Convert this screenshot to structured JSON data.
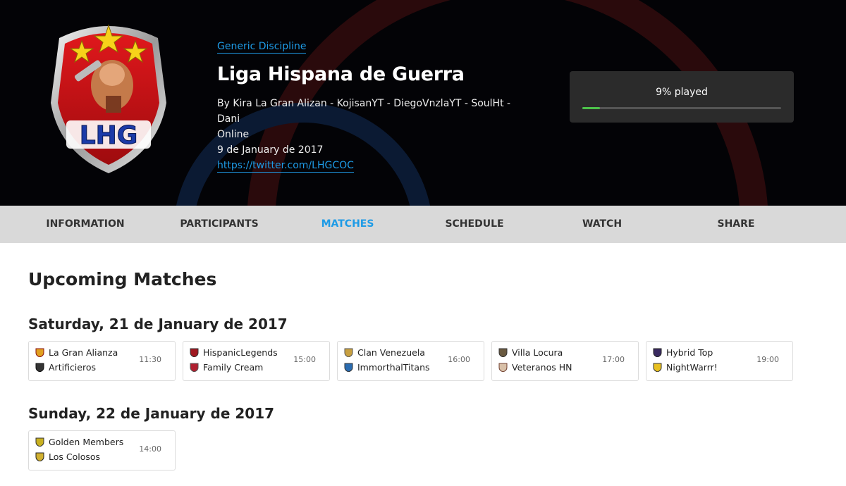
{
  "tournament": {
    "discipline": "Generic Discipline",
    "title": "Liga Hispana de Guerra",
    "organizers_line1": "By Kira La Gran Alizan - KojisanYT - DiegoVnzlaYT - SoulHt - Dani",
    "organizers_line2": "Online",
    "date": "9 de January de 2017",
    "link": "https://twitter.com/LHGCOC",
    "logo_text": "LHG"
  },
  "progress": {
    "label": "9% played",
    "value": 0.09
  },
  "nav": {
    "items": [
      {
        "label": "INFORMATION"
      },
      {
        "label": "PARTICIPANTS"
      },
      {
        "label": "MATCHES"
      },
      {
        "label": "SCHEDULE"
      },
      {
        "label": "WATCH"
      },
      {
        "label": "SHARE"
      }
    ],
    "active": "MATCHES"
  },
  "upcoming": {
    "title": "Upcoming Matches",
    "days": [
      {
        "label": "Saturday, 21 de January de 2017",
        "matches": [
          {
            "team1": "La Gran Alianza",
            "team2": "Artificieros",
            "time": "11:30"
          },
          {
            "team1": "HispanicLegends",
            "team2": "Family Cream",
            "time": "15:00"
          },
          {
            "team1": "Clan Venezuela",
            "team2": "ImmorthalTitans",
            "time": "16:00"
          },
          {
            "team1": "Villa Locura",
            "team2": "Veteranos HN",
            "time": "17:00"
          },
          {
            "team1": "Hybrid Top",
            "team2": "NightWarrr!",
            "time": "19:00"
          }
        ]
      },
      {
        "label": "Sunday, 22 de January de 2017",
        "matches": [
          {
            "team1": "Golden Members",
            "team2": "Los Colosos",
            "time": "14:00"
          }
        ]
      }
    ]
  },
  "colors": {
    "accent": "#1e9be6",
    "progress": "#4cc24a",
    "hero_bg": "#030306",
    "nav_bg": "#d9d9d9"
  }
}
